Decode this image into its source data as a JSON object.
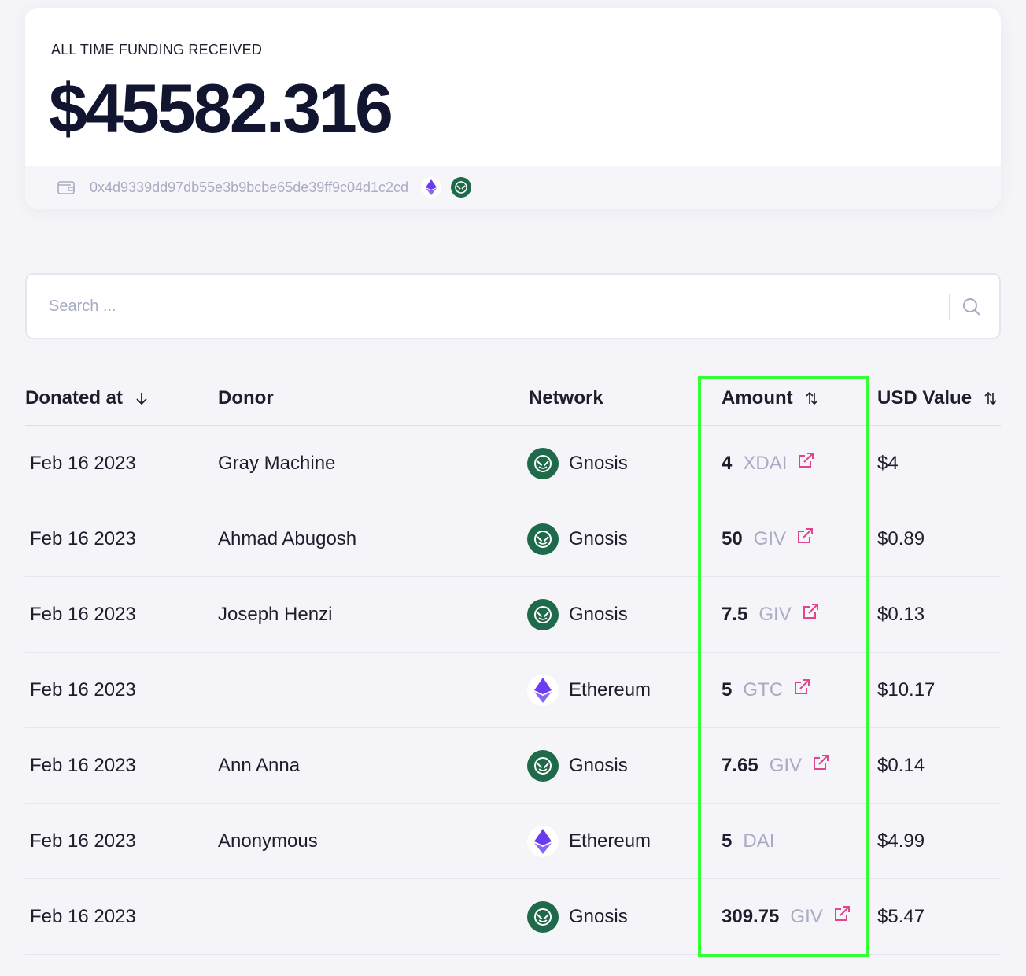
{
  "funding": {
    "label": "ALL TIME FUNDING RECEIVED",
    "amount": "$45582.316",
    "wallet_address": "0x4d9339dd97db55e3b9bcbe65de39ff9c04d1c2cd",
    "wallet_icon": "wallet-icon",
    "networks": [
      "ethereum-icon",
      "gnosis-icon"
    ]
  },
  "search": {
    "placeholder": "Search ...",
    "icon": "search-icon"
  },
  "table": {
    "headers": {
      "donated_at": "Donated at",
      "donor": "Donor",
      "network": "Network",
      "amount": "Amount",
      "usd_value": "USD Value"
    },
    "rows": [
      {
        "date": "Feb 16 2023",
        "donor": "Gray Machine",
        "network": "Gnosis",
        "network_icon": "gnosis-icon",
        "amount": "4",
        "currency": "XDAI",
        "has_link": true,
        "usd": "$4"
      },
      {
        "date": "Feb 16 2023",
        "donor": "Ahmad Abugosh",
        "network": "Gnosis",
        "network_icon": "gnosis-icon",
        "amount": "50",
        "currency": "GIV",
        "has_link": true,
        "usd": "$0.89"
      },
      {
        "date": "Feb 16 2023",
        "donor": "Joseph Henzi",
        "network": "Gnosis",
        "network_icon": "gnosis-icon",
        "amount": "7.5",
        "currency": "GIV",
        "has_link": true,
        "usd": "$0.13"
      },
      {
        "date": "Feb 16 2023",
        "donor": "",
        "network": "Ethereum",
        "network_icon": "ethereum-icon",
        "amount": "5",
        "currency": "GTC",
        "has_link": true,
        "usd": "$10.17"
      },
      {
        "date": "Feb 16 2023",
        "donor": "Ann Anna",
        "network": "Gnosis",
        "network_icon": "gnosis-icon",
        "amount": "7.65",
        "currency": "GIV",
        "has_link": true,
        "usd": "$0.14"
      },
      {
        "date": "Feb 16 2023",
        "donor": "Anonymous",
        "network": "Ethereum",
        "network_icon": "ethereum-icon",
        "amount": "5",
        "currency": "DAI",
        "has_link": false,
        "usd": "$4.99"
      },
      {
        "date": "Feb 16 2023",
        "donor": "",
        "network": "Gnosis",
        "network_icon": "gnosis-icon",
        "amount": "309.75",
        "currency": "GIV",
        "has_link": true,
        "usd": "$5.47"
      }
    ]
  },
  "colors": {
    "highlight": "#33ff33",
    "link_pink": "#e1458d",
    "gnosis_green": "#1f6a4a",
    "ethereum_purple": "#6a3cf0",
    "muted_text": "#a9abc4"
  }
}
